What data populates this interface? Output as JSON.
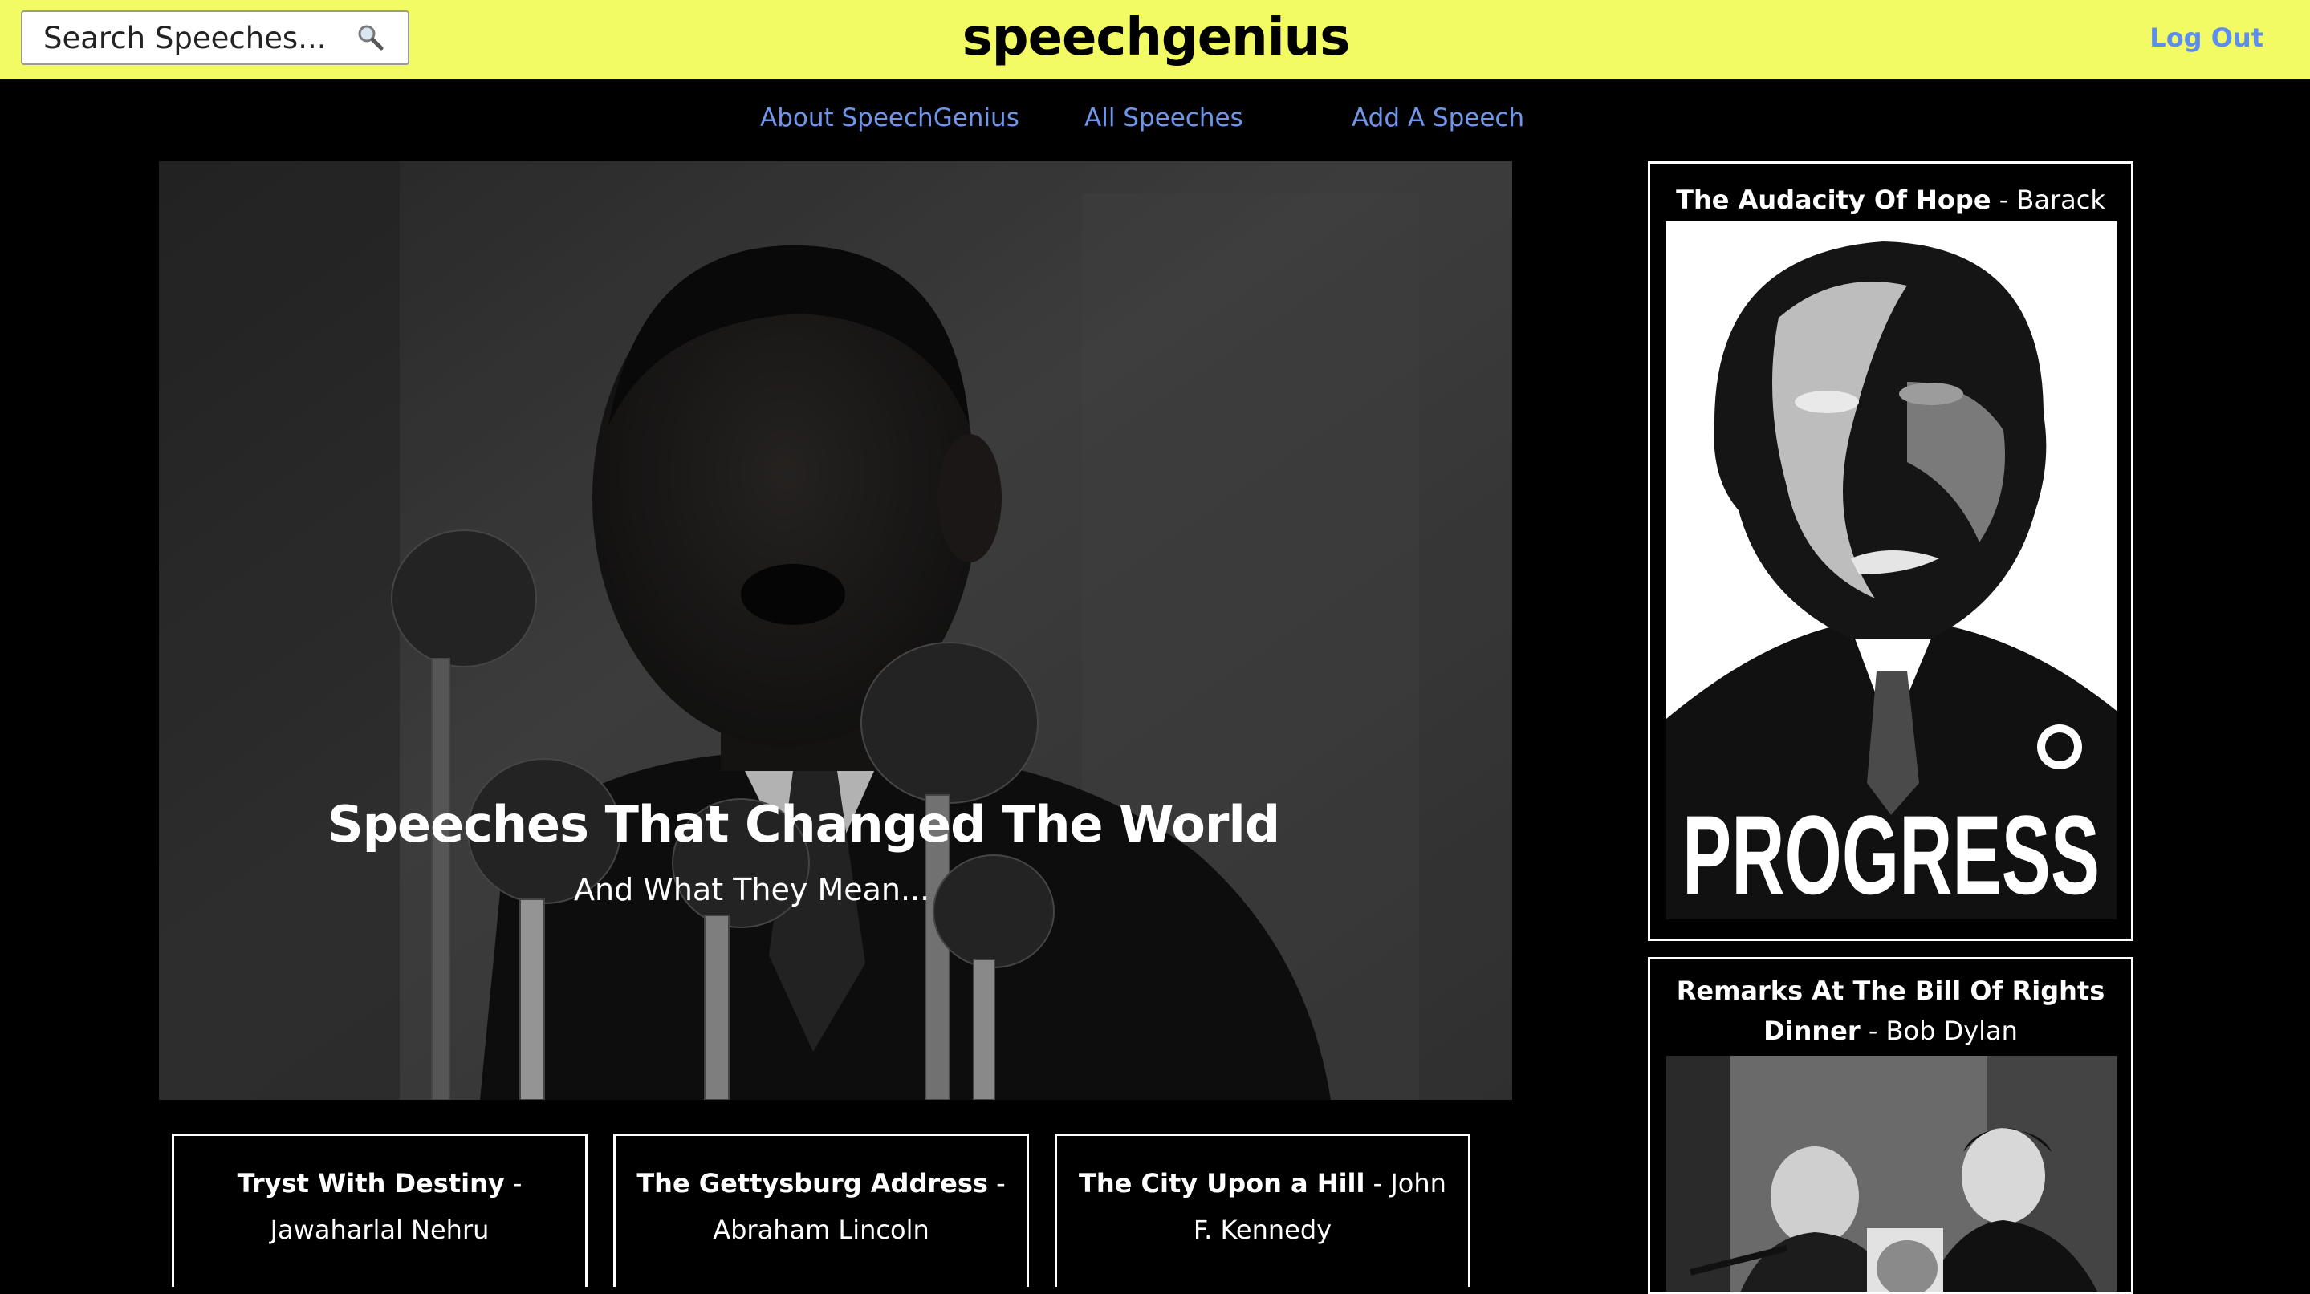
{
  "header": {
    "search_placeholder": "Search Speeches...",
    "search_icon": "magnifier-icon",
    "brand": "speechgenius",
    "logout_label": "Log Out",
    "background_color": "#f2fb63",
    "link_color": "#5e8df0"
  },
  "nav": {
    "items": [
      {
        "label": "About SpeechGenius"
      },
      {
        "label": "All Speeches"
      },
      {
        "label": "Add A Speech"
      }
    ]
  },
  "hero": {
    "title": "Speeches That Changed The World",
    "subtitle": "And What They Mean..."
  },
  "featured": [
    {
      "title": "The Audacity Of Hope",
      "separator": " - ",
      "speaker": "Barack Obama",
      "poster_text": "PROGRESS"
    },
    {
      "title": "Remarks At The Bill Of Rights Dinner",
      "separator": " - ",
      "speaker": "Bob Dylan"
    }
  ],
  "speeches": [
    {
      "title": "Tryst With Destiny",
      "separator": " - ",
      "speaker": "Jawaharlal Nehru"
    },
    {
      "title": "The Gettysburg Address",
      "separator": " - ",
      "speaker": "Abraham Lincoln"
    },
    {
      "title": "The City Upon a Hill",
      "separator": " - ",
      "speaker": "John F. Kennedy"
    }
  ]
}
